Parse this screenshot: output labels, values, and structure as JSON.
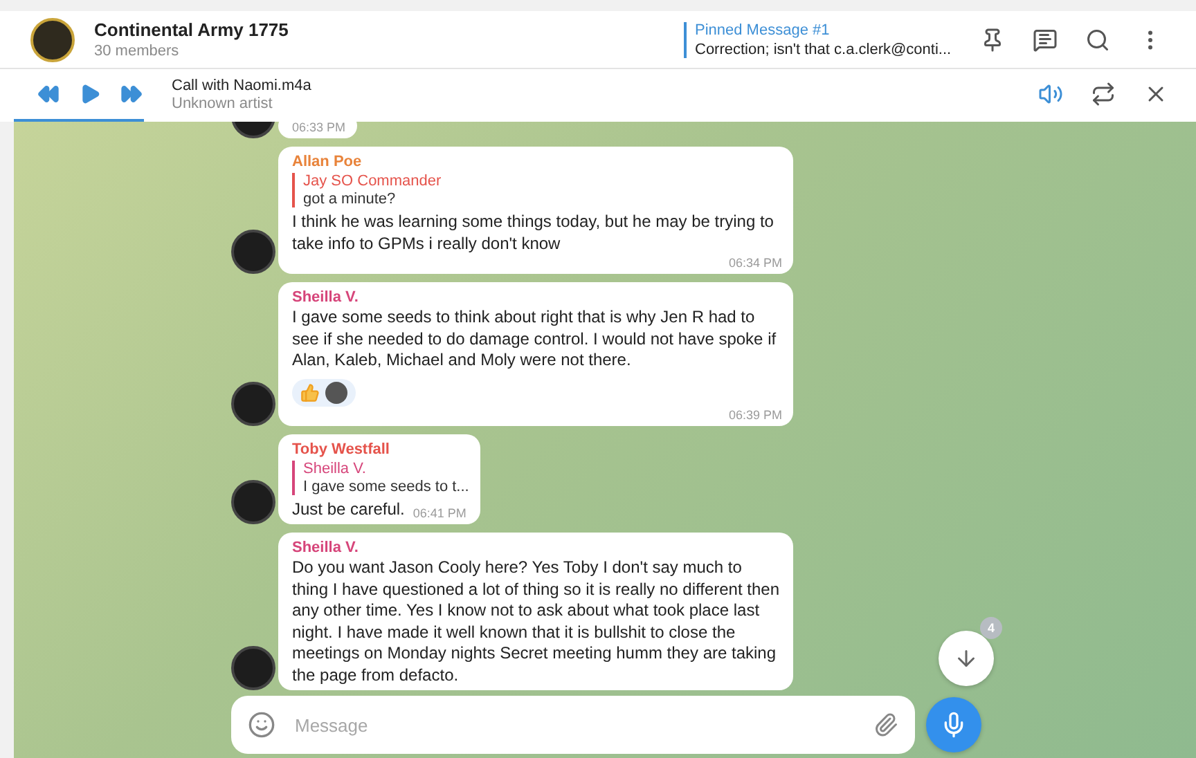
{
  "chat": {
    "title": "Continental Army 1775",
    "subtitle": "30 members"
  },
  "pinned": {
    "label": "Pinned Message #1",
    "text": "Correction; isn't that c.a.clerk@conti..."
  },
  "player": {
    "title": "Call with Naomi.m4a",
    "artist": "Unknown artist",
    "level": 0.11
  },
  "messages": [
    {
      "time": "06:33 PM"
    },
    {
      "author": "Allan Poe",
      "color": "#e8833a",
      "reply": {
        "author": "Jay SO Commander",
        "text": "got a minute?",
        "color": "#e5534b"
      },
      "text": "I think he was learning some things today, but he may be trying to take info to GPMs i really don't know",
      "time": "06:34 PM"
    },
    {
      "author": "Sheilla V.",
      "color": "#d6457a",
      "text": "I gave some seeds to think about right that is why Jen R had to see if she needed to do damage control. I would not have spoke if Alan, Kaleb, Michael and Moly were not there.",
      "time": "06:39 PM",
      "reactions": true
    },
    {
      "author": "Toby Westfall",
      "color": "#e5534b",
      "reply": {
        "author": "Sheilla V.",
        "text": "I gave some seeds to t...",
        "color": "#d6457a"
      },
      "text": "Just be careful.",
      "time": "06:41 PM"
    },
    {
      "author": "Sheilla V.",
      "color": "#d6457a",
      "text": "Do you want Jason Cooly here? Yes Toby I don't say much to thing I have questioned a lot of thing so it is really no different then any other time. Yes I know not to ask about what took place last night. I have made it well known that it is bullshit to close the meetings on Monday nights Secret meeting humm they are taking the page from defacto."
    }
  ],
  "composer": {
    "placeholder": "Message"
  },
  "scroll_down": {
    "badge": "4"
  }
}
